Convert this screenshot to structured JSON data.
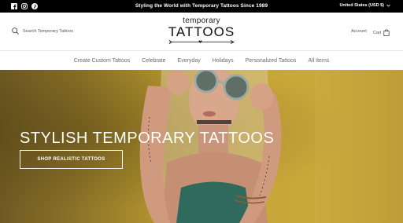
{
  "topbar": {
    "announcement": "Styling the World with Temporary Tattoos Since 1989",
    "region": "United States (USD $)",
    "socials": [
      "facebook-icon",
      "instagram-icon",
      "pinterest-icon"
    ]
  },
  "header": {
    "search_placeholder": "Search Temporary Tattoos",
    "logo_line1": "temporary",
    "logo_line2": "TATTOOS",
    "account_label": "Account",
    "cart_label": "Cart"
  },
  "nav": {
    "items": [
      "Create Custom Tattoos",
      "Celebrate",
      "Everyday",
      "Holidays",
      "Personalized Tattoos",
      "All Items"
    ]
  },
  "hero": {
    "title": "STYLISH TEMPORARY TATTOOS",
    "button_label": "SHOP REALISTIC TATTOOS"
  },
  "colors": {
    "topbar_bg": "#000000",
    "hero_bg": "#c9a83a",
    "nav_text": "#6b6b6b"
  }
}
